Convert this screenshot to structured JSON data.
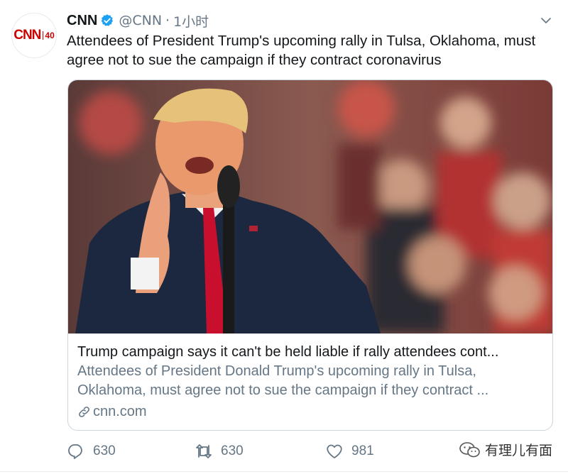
{
  "tweet": {
    "author_name": "CNN",
    "handle": "@CNN",
    "separator": "·",
    "time": "1小时",
    "text": "Attendees of President Trump's upcoming rally in Tulsa, Oklahoma, must agree not to sue the campaign if they contract coronavirus",
    "avatar": {
      "logo_text": "CNN",
      "badge_text": "40"
    }
  },
  "card": {
    "title": "Trump campaign says it can't be held liable if rally attendees cont...",
    "description": "Attendees of President Donald Trump's upcoming rally in Tulsa, Oklahoma, must agree not to sue the campaign if they contract ...",
    "domain": "cnn.com",
    "image_icon": "photo-of-speaker-at-rally"
  },
  "actions": {
    "reply_count": "630",
    "retweet_count": "630",
    "like_count": "981"
  },
  "watermark": {
    "text": "有理儿有面",
    "icon": "wechat-icon"
  },
  "colors": {
    "verified": "#1da1f2",
    "brand": "#cc0000",
    "muted": "#657786",
    "border": "#ccd6dd"
  }
}
